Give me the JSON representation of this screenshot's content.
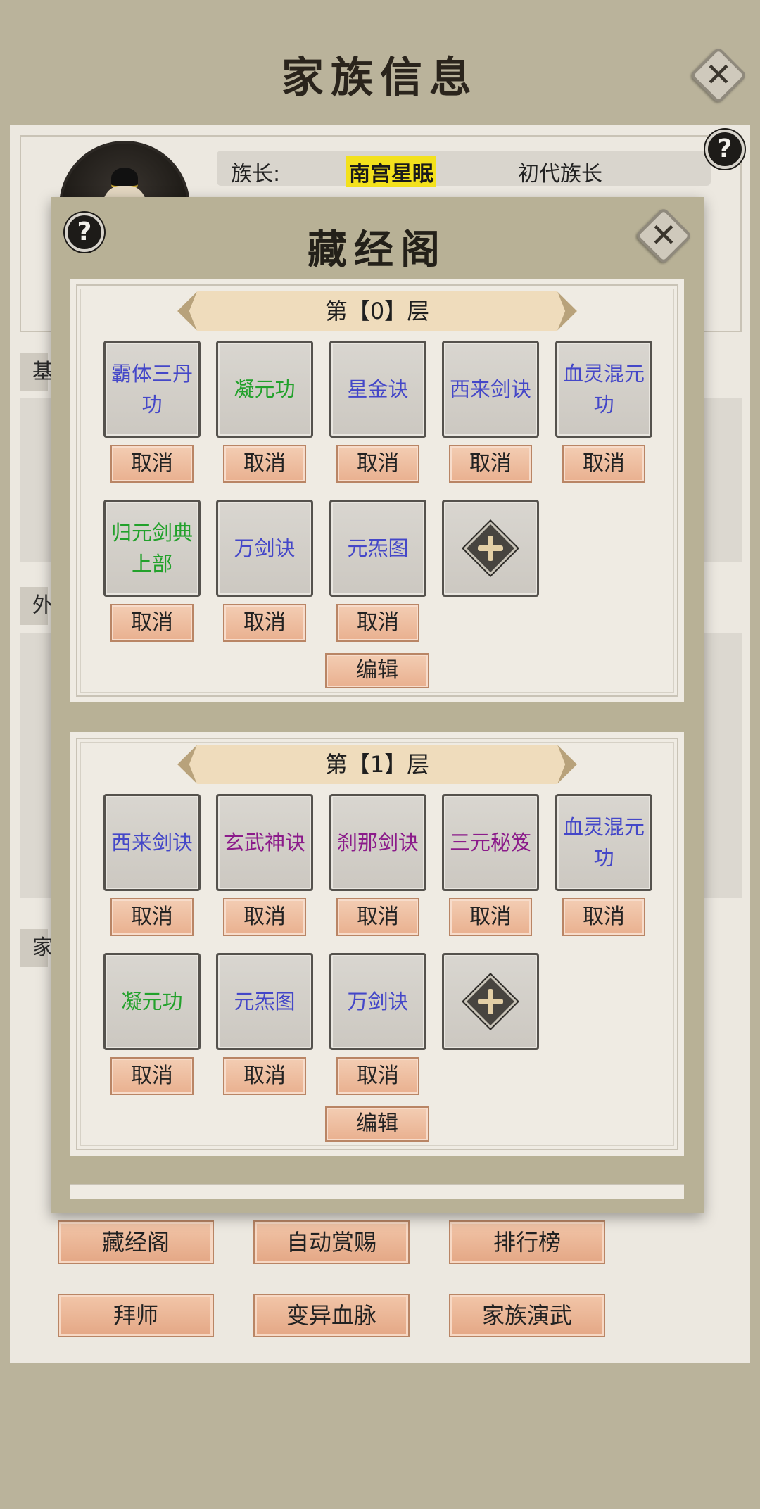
{
  "page": {
    "title": "家族信息",
    "chief_label": "族长:",
    "chief_name": "南宫星眠",
    "chief_rank": "初代族长",
    "section_tags": [
      "基",
      "外",
      "家"
    ]
  },
  "modal": {
    "title": "藏经阁",
    "floors": [
      {
        "label": "第【0】层",
        "books": [
          {
            "name": "霸体三丹功",
            "color": "#4447c8"
          },
          {
            "name": "凝元功",
            "color": "#22a12b"
          },
          {
            "name": "星金诀",
            "color": "#4447c8"
          },
          {
            "name": "西来剑诀",
            "color": "#4447c8"
          },
          {
            "name": "血灵混元功",
            "color": "#4447c8"
          },
          {
            "name": "归元剑典上部",
            "color": "#22a12b"
          },
          {
            "name": "万剑诀",
            "color": "#4447c8"
          },
          {
            "name": "元炁图",
            "color": "#4447c8"
          }
        ],
        "cancel_label": "取消",
        "edit_label": "编辑"
      },
      {
        "label": "第【1】层",
        "books": [
          {
            "name": "西来剑诀",
            "color": "#4447c8"
          },
          {
            "name": "玄武神诀",
            "color": "#8b1b8a"
          },
          {
            "name": "刹那剑诀",
            "color": "#8b1b8a"
          },
          {
            "name": "三元秘笈",
            "color": "#8b1b8a"
          },
          {
            "name": "血灵混元功",
            "color": "#4447c8"
          },
          {
            "name": "凝元功",
            "color": "#22a12b"
          },
          {
            "name": "元炁图",
            "color": "#4447c8"
          },
          {
            "name": "万剑诀",
            "color": "#4447c8"
          }
        ],
        "cancel_label": "取消",
        "edit_label": "编辑"
      }
    ]
  },
  "bottom_buttons": [
    "藏经阁",
    "自动赏赐",
    "排行榜",
    "拜师",
    "变异血脉",
    "家族演武"
  ],
  "icons": {
    "close": "close-icon",
    "help": "question-icon",
    "add": "add-plus-icon"
  }
}
